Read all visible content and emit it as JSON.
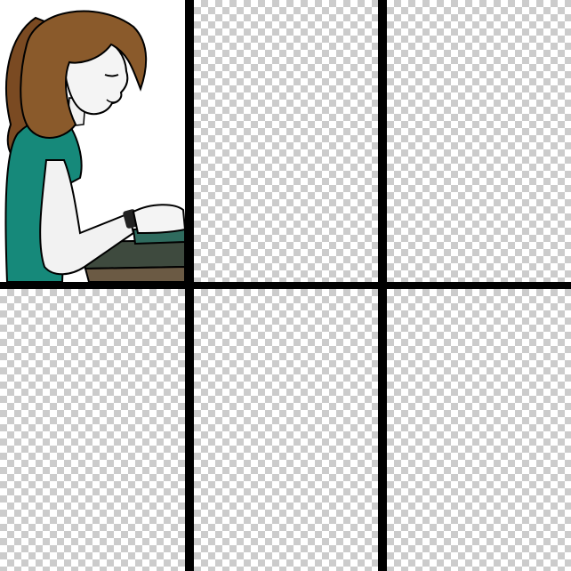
{
  "comic": {
    "layout": "3x2 grid",
    "gutter_color": "#000000",
    "empty_panel_pattern": "transparency-checkerboard",
    "panels": [
      {
        "index": 1,
        "content": "character-illustration"
      },
      {
        "index": 2,
        "content": "empty"
      },
      {
        "index": 3,
        "content": "empty"
      },
      {
        "index": 4,
        "content": "empty"
      },
      {
        "index": 5,
        "content": "empty"
      },
      {
        "index": 6,
        "content": "empty"
      }
    ]
  },
  "colors": {
    "hair": "#8a5a2b",
    "shirt": "#16897a",
    "skin": "#f4f4f4",
    "desk": "#4a4a3c",
    "keyboard": "#2f6b5e"
  }
}
